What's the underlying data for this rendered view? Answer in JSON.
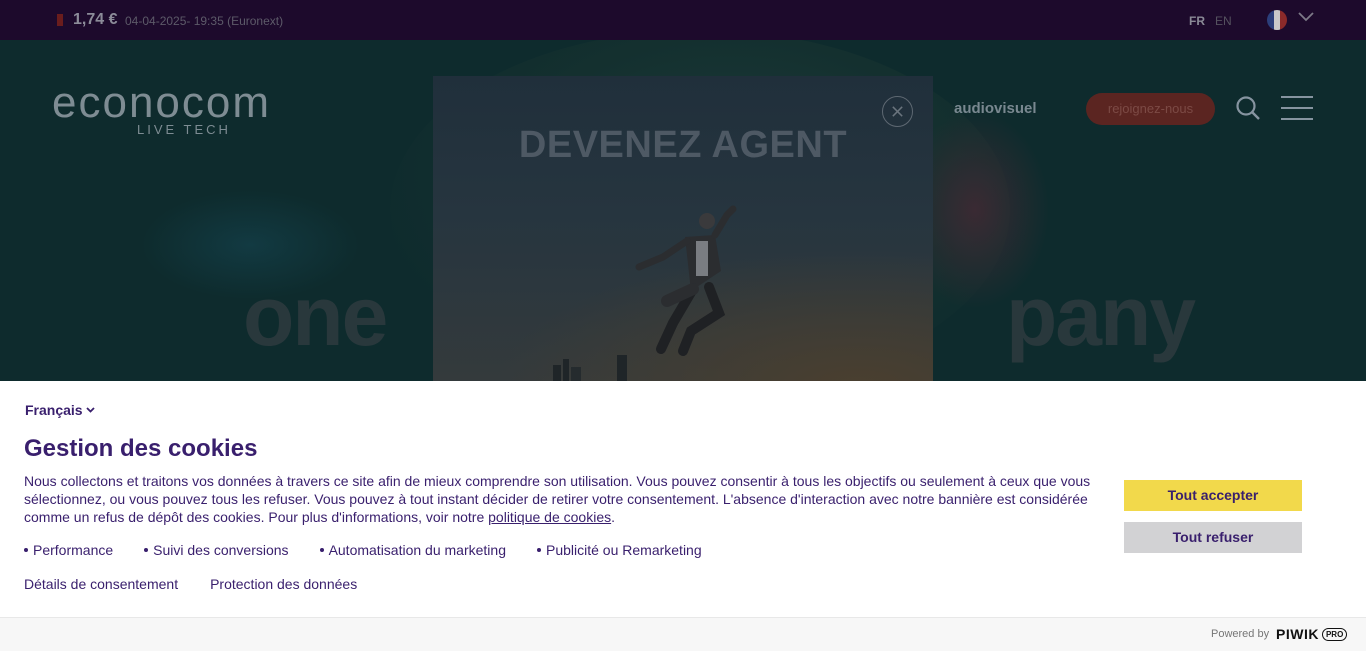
{
  "topbar": {
    "price": "1,74 €",
    "price_date": "04-04-2025- 19:35 (Euronext)",
    "lang_fr": "FR",
    "lang_en": "EN",
    "flag_colors": [
      "#2b3e7a",
      "#c9c9c9",
      "#8b2a2a"
    ]
  },
  "header": {
    "logo": "econocom",
    "logo_tagline": "LIVE TECH",
    "nav_item": "audiovisuel",
    "join_label": "rejoignez-nous",
    "join_color": "#5b2521"
  },
  "hero": {
    "word_left": "one",
    "word_right": "pany"
  },
  "modal": {
    "title": "DEVENEZ AGENT"
  },
  "cookie_banner": {
    "language": "Français",
    "title": "Gestion des cookies",
    "text": "Nous collectons et traitons vos données à travers ce site afin de mieux comprendre son utilisation. Vous pouvez consentir à tous les objectifs ou seulement à ceux que vous sélectionnez, ou vous pouvez tous les refuser. Vous pouvez à tout instant décider de retirer votre consentement. L'absence d'interaction avec notre bannière est considérée comme un refus de dépôt des cookies. Pour plus d'informations, voir notre",
    "policy_link": "politique de cookies",
    "text_end": ".",
    "purposes": [
      "Performance",
      "Suivi des conversions",
      "Automatisation du marketing",
      "Publicité ou Remarketing"
    ],
    "consent_details": "Détails de consentement",
    "data_protection": "Protection des données",
    "accept_label": "Tout accepter",
    "refuse_label": "Tout refuser",
    "accept_color": "#f2d94b",
    "refuse_color": "#d2d2d4",
    "text_color": "#391f6d"
  },
  "footer": {
    "powered_by": "Powered by",
    "brand": "PIWIK",
    "brand_badge": "PRO"
  }
}
